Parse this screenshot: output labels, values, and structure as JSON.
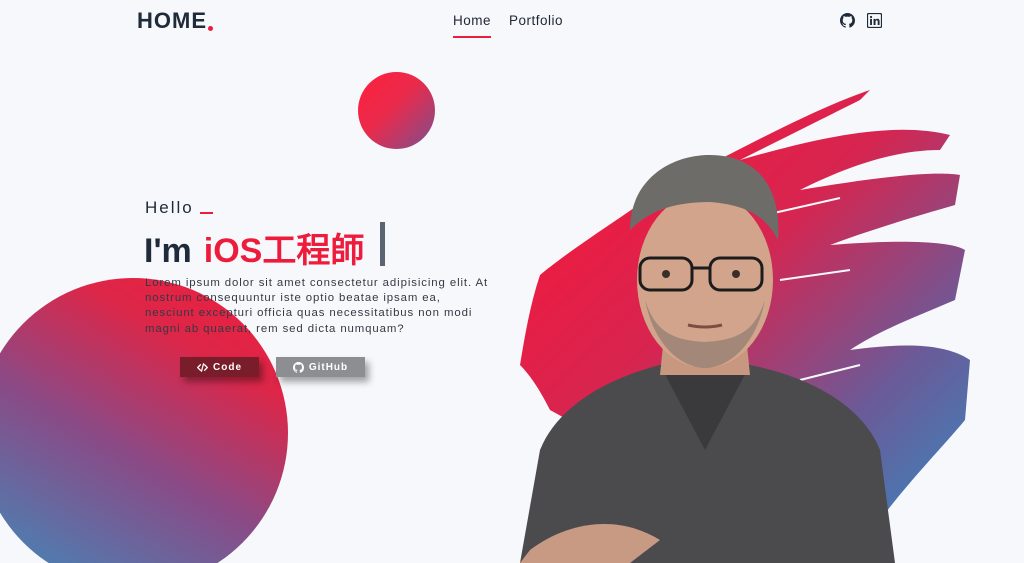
{
  "header": {
    "logo": "HOME",
    "nav": [
      {
        "label": "Home",
        "active": true
      },
      {
        "label": "Portfolio",
        "active": false
      }
    ],
    "social_icons": [
      "github-icon",
      "linkedin-icon"
    ]
  },
  "hero": {
    "greeting": "Hello",
    "prefix": "I'm",
    "role": "iOS工程師",
    "description": "Lorem ipsum dolor sit amet consectetur adipisicing elit. At nostrum consequuntur iste optio beatae ipsam ea, nesciunt excepturi officia quas necessitatibus non modi magni ab quaerat, rem sed dicta numquam?",
    "buttons": {
      "code": "Code",
      "github": "GitHub"
    }
  },
  "colors": {
    "accent": "#ee1c3c",
    "dark": "#1f2a3a",
    "code_button": "#7a1d2a",
    "github_button": "#8d8e91",
    "gradient_blue": "#3a8fbf"
  }
}
